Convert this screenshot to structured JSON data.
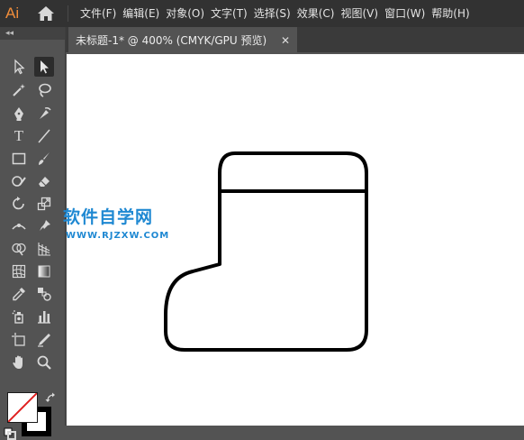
{
  "app": {
    "logo": "Ai"
  },
  "menu": {
    "items": [
      {
        "label": "文件(F)"
      },
      {
        "label": "编辑(E)"
      },
      {
        "label": "对象(O)"
      },
      {
        "label": "文字(T)"
      },
      {
        "label": "选择(S)"
      },
      {
        "label": "效果(C)"
      },
      {
        "label": "视图(V)"
      },
      {
        "label": "窗口(W)"
      },
      {
        "label": "帮助(H)"
      }
    ]
  },
  "panel": {
    "collapse": "◂◂"
  },
  "document_tab": {
    "label": "未标题-1* @ 400% (CMYK/GPU 预览)",
    "close": "✕"
  },
  "tools": {
    "type_tool_glyph": "T"
  },
  "watermark": {
    "title": "软件自学网",
    "url": "WWW.RJZXW.COM"
  },
  "colors": {
    "accent": "#f08d3b",
    "watermark": "#1e88d2",
    "ui_dark": "#323232",
    "ui_mid": "#535353"
  }
}
